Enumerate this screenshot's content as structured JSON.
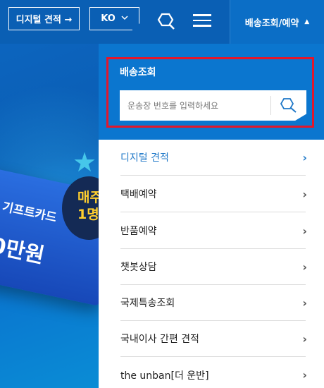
{
  "header": {
    "estimate_button": "디지털 견적 →",
    "lang_button": "KO",
    "delivery_tab": "배송조회/예약"
  },
  "hero": {
    "giftcard_title": "기프트카드",
    "giftcard_amount": "0만원",
    "promo_line1": "매주",
    "promo_line2": "1명"
  },
  "tracking": {
    "title": "배송조회",
    "placeholder": "운송장 번호를 입력하세요"
  },
  "menu": {
    "items": [
      {
        "label": "디지털 견적"
      },
      {
        "label": "택배예약"
      },
      {
        "label": "반품예약"
      },
      {
        "label": "챗봇상담"
      },
      {
        "label": "국제특송조회"
      },
      {
        "label": "국내이사 간편 견적"
      },
      {
        "label": "the unban[더 운반]"
      }
    ]
  }
}
